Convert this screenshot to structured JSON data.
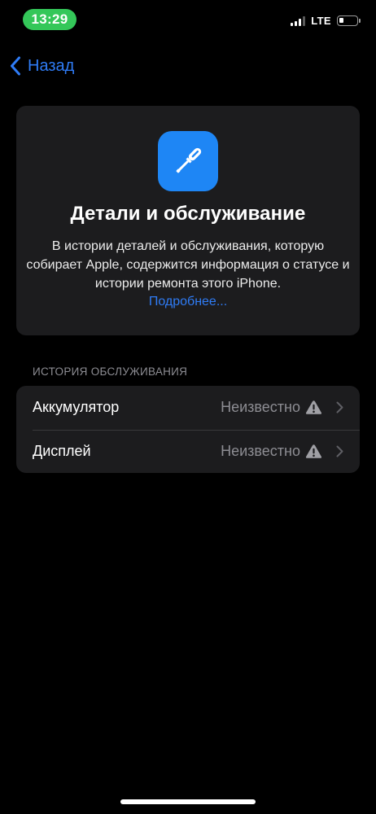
{
  "status_bar": {
    "time": "13:29",
    "network": "LTE",
    "signal_bars": 3,
    "battery_level": 0.25
  },
  "nav": {
    "back_label": "Назад"
  },
  "info_card": {
    "icon": "screwdriver-icon",
    "title": "Детали и обслуживание",
    "description": "В истории деталей и обслуживания, которую собирает Apple, содержится информация о статусе и истории ремонта этого iPhone.",
    "more_link": "Подробнее..."
  },
  "service_history": {
    "header": "ИСТОРИЯ ОБСЛУЖИВАНИЯ",
    "items": [
      {
        "label": "Аккумулятор",
        "value": "Неизвестно",
        "icon": "warning-icon"
      },
      {
        "label": "Дисплей",
        "value": "Неизвестно",
        "icon": "warning-icon"
      }
    ]
  },
  "colors": {
    "accent": "#2f7cf6",
    "time_pill": "#34c759",
    "card": "#1c1c1e",
    "icon_bg": "#1e86f5"
  }
}
